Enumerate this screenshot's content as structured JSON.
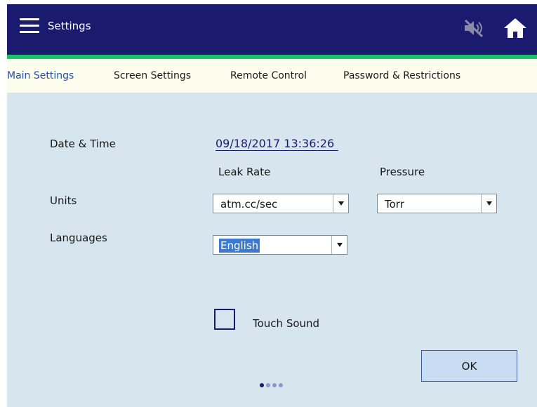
{
  "header": {
    "title": "Settings",
    "menu_icon": "hamburger-menu-icon",
    "mute_icon": "speaker-muted-icon",
    "home_icon": "home-icon"
  },
  "tabs": [
    {
      "label": "Main Settings",
      "active": true
    },
    {
      "label": "Screen Settings",
      "active": false
    },
    {
      "label": "Remote Control",
      "active": false
    },
    {
      "label": "Password & Restrictions",
      "active": false
    }
  ],
  "main": {
    "date_time": {
      "label": "Date & Time",
      "value": "09/18/2017 13:36:26"
    },
    "units": {
      "label": "Units",
      "leak_rate": {
        "label": "Leak Rate",
        "value": "atm.cc/sec"
      },
      "pressure": {
        "label": "Pressure",
        "value": "Torr"
      }
    },
    "languages": {
      "label": "Languages",
      "value": "English"
    },
    "touch_sound": {
      "label": "Touch Sound",
      "checked": false
    },
    "ok_label": "OK"
  },
  "pager": {
    "total": 4,
    "current": 1
  },
  "colors": {
    "header_bg": "#1a1a6e",
    "accent_green": "#1fbf6a",
    "tab_bar_bg": "#fdfdee",
    "active_tab": "#1f4fa8",
    "content_bg": "#d6e5ee",
    "selection": "#3a7ad6"
  }
}
